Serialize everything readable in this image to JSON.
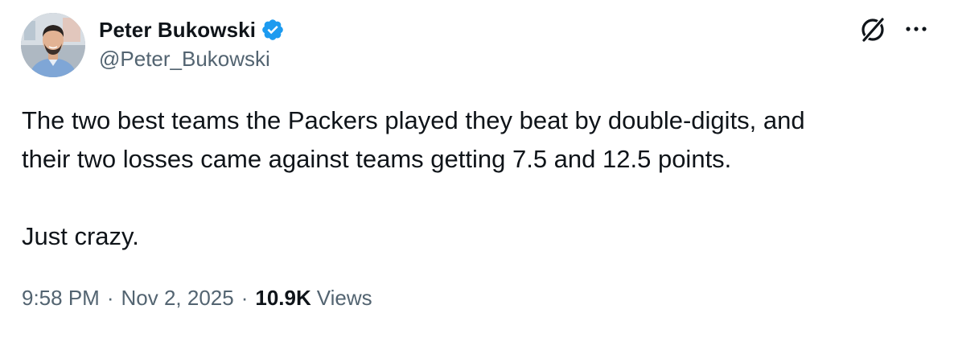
{
  "author": {
    "display_name": "Peter Bukowski",
    "handle": "@Peter_Bukowski",
    "verified": true
  },
  "tweet": {
    "lines": [
      "The two best teams the Packers played they beat by double-digits, and",
      "their two losses came against teams getting 7.5 and 12.5 points.",
      "Just crazy."
    ]
  },
  "meta": {
    "time": "9:58 PM",
    "separator": "·",
    "date": "Nov 2, 2025",
    "views_count": "10.9K",
    "views_label": "Views"
  },
  "icons": {
    "verified": "verified-badge-icon",
    "grok": "grok-icon",
    "more": "more-options-icon"
  },
  "colors": {
    "text": "#0f1419",
    "secondary": "#536471",
    "verified_blue": "#1d9bf0"
  }
}
